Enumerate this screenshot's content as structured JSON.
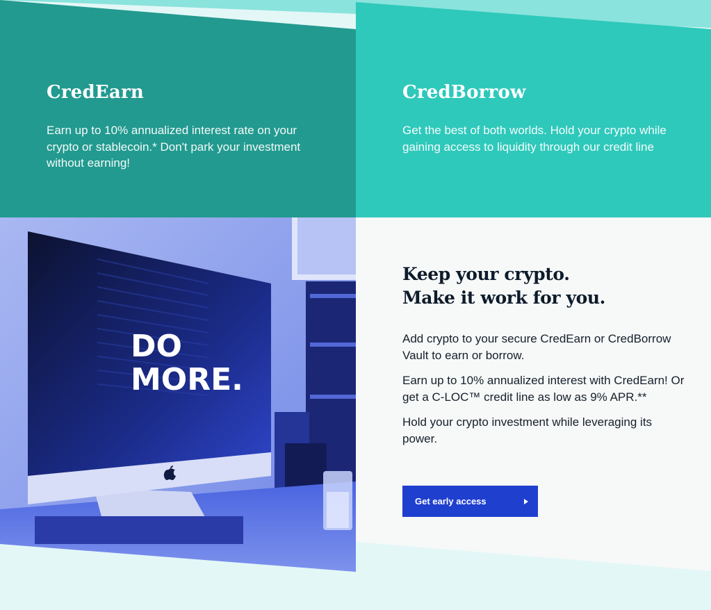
{
  "colors": {
    "earn_panel": "#229a8f",
    "borrow_panel": "#2ec9bb",
    "top_strip": "#8ae3dc",
    "hero_bg": "#f7f8f8",
    "page_bottom": "#e3f7f7",
    "cta": "#1f3fcf",
    "photo_tint": "#2845d6"
  },
  "cards": [
    {
      "title": "CredEarn",
      "body": "Earn up to 10% annualized interest rate on your crypto or stablecoin.* Don't park your investment without earning!"
    },
    {
      "title": "CredBorrow",
      "body": "Get the best of both worlds. Hold your crypto while gaining access to liquidity through our credit line"
    }
  ],
  "hero": {
    "heading_line1": "Keep your crypto.",
    "heading_line2": "Make it work for you.",
    "paragraphs": [
      "Add crypto to your secure CredEarn or CredBorrow Vault to earn or borrow.",
      "Earn up to 10% annualized interest with CredEarn! Or get a C-LOC™ credit line as low as 9% APR.**",
      "Hold your crypto investment while leveraging its power."
    ],
    "cta_label": "Get early access",
    "cta_icon": "play-arrow-icon"
  },
  "photo": {
    "screen_line1": "DO",
    "screen_line2": "MORE.",
    "logo_icon": "apple-logo-icon"
  }
}
